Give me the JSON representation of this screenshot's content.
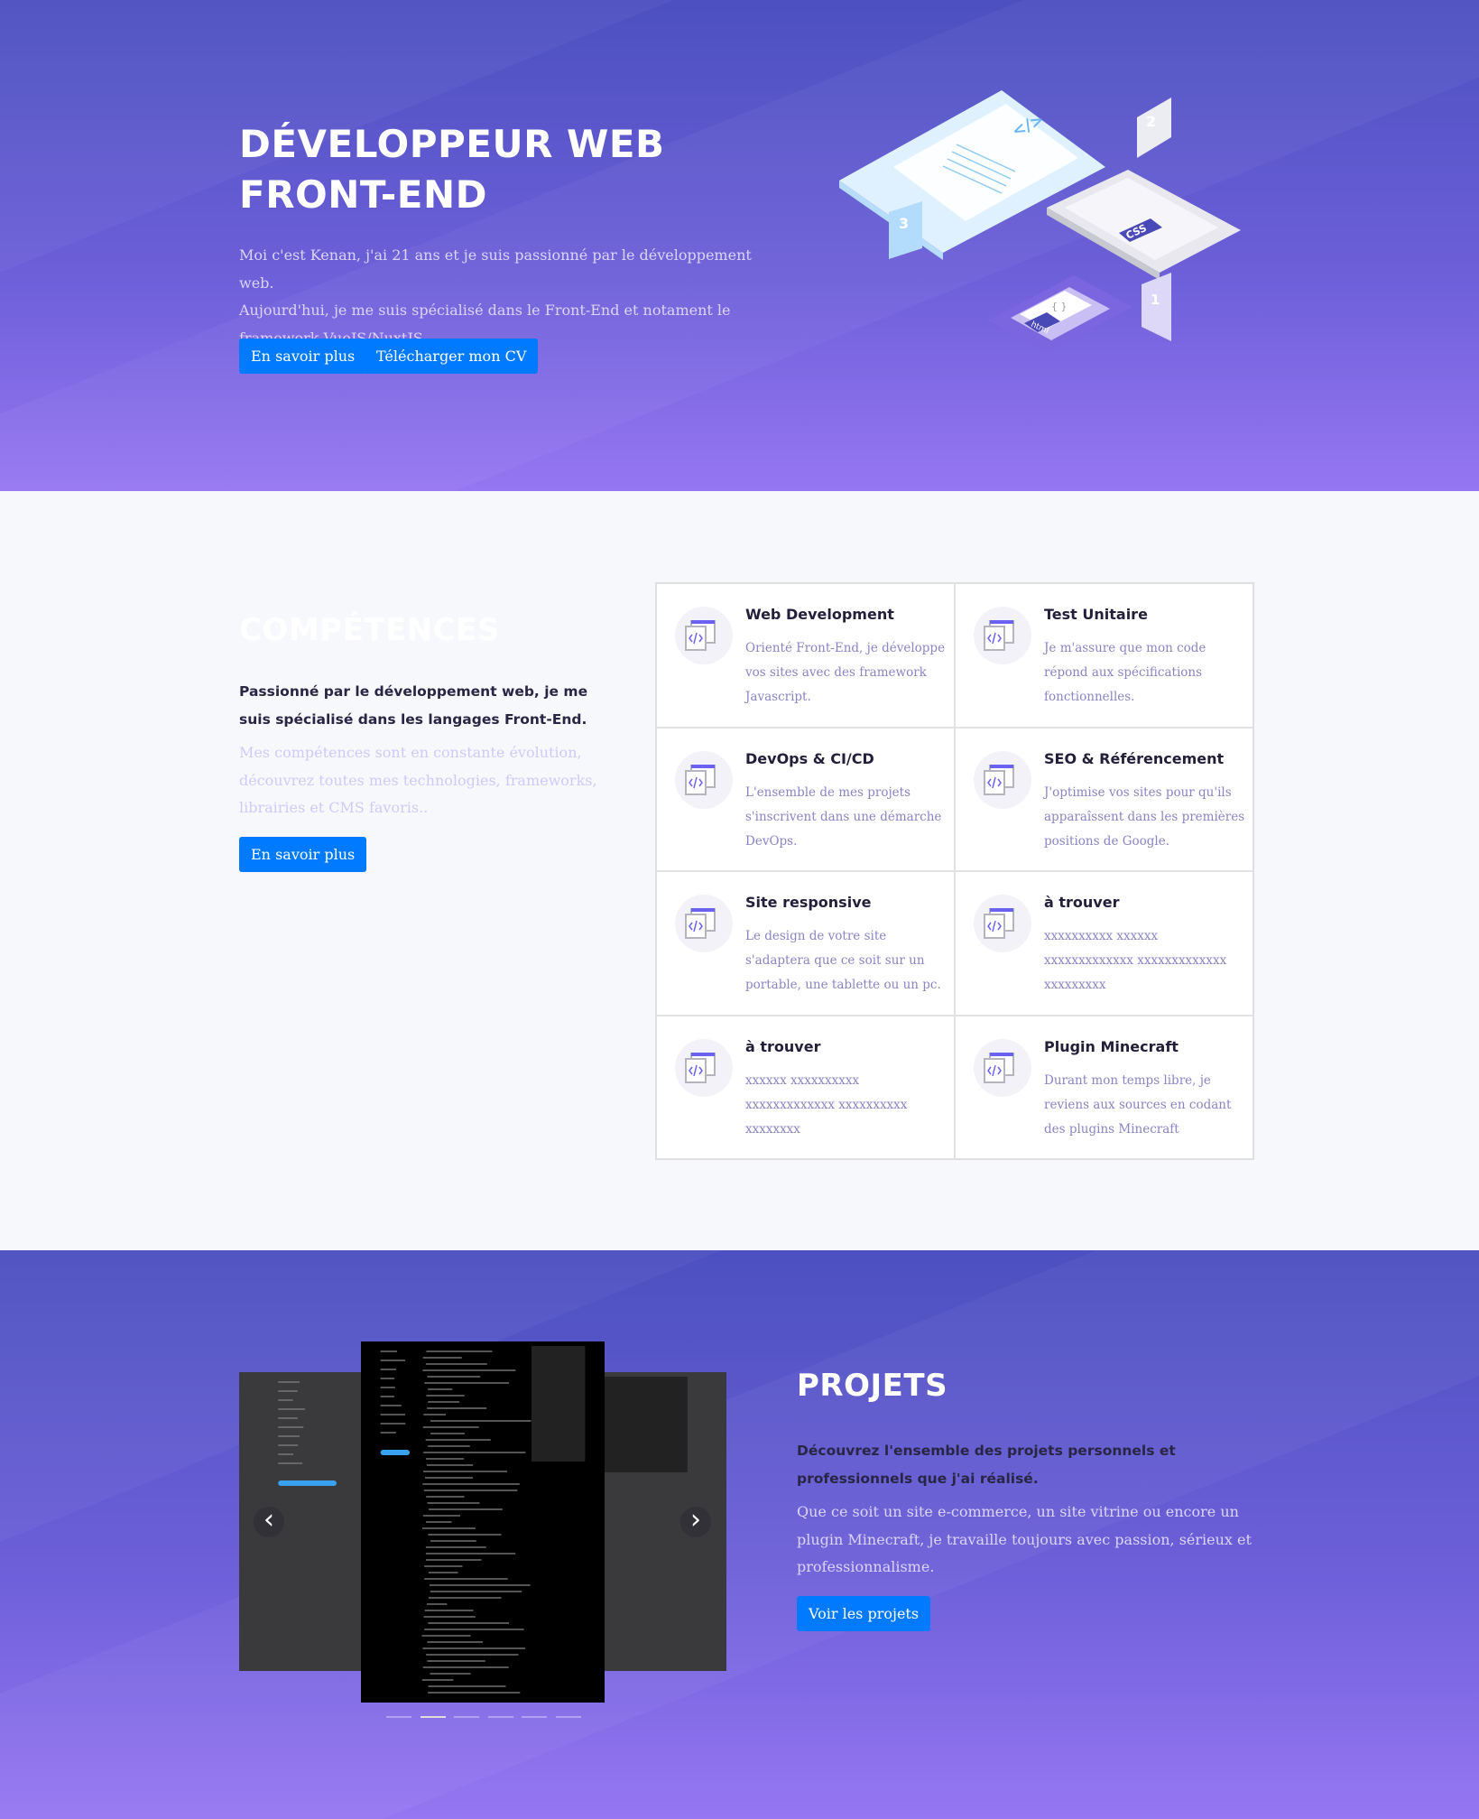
{
  "hero": {
    "title_line1": "DÉVELOPPEUR WEB",
    "title_line2": "FRONT-END",
    "lines": [
      "Moi c'est Kenan, j'ai 21 ans et je suis passionné par le développement web.",
      "Aujourd'hui, je me suis spécialisé dans le Front-End et notament le",
      "framework VueJS/NuxtJS."
    ],
    "btn_more": "En savoir plus",
    "btn_cv": "Télécharger mon CV",
    "illustration_labels": {
      "one": "1",
      "two": "2",
      "three": "3",
      "css": "CSS",
      "html": "html",
      "code": "</>",
      "braces": "{ }"
    }
  },
  "skills": {
    "title": "COMPÉTENCES",
    "strong_lines": [
      "Passionné par le développement web, je me",
      "suis spécialisé dans les langages Front-End."
    ],
    "light_lines": [
      "Mes compétences sont en constante évolution,",
      "découvrez toutes mes technologies, frameworks,",
      "librairies et CMS favoris.."
    ],
    "btn": "En savoir plus",
    "cards": [
      {
        "title": "Web Development",
        "desc": "Orienté Front-End, je développe vos sites avec des framework Javascript.",
        "icon": "code-window-icon"
      },
      {
        "title": "Test Unitaire",
        "desc": "Je m'assure que mon code répond aux spécifications fonctionnelles.",
        "icon": "code-window-icon"
      },
      {
        "title": "DevOps & CI/CD",
        "desc": "L'ensemble de mes projets s'inscrivent dans une démarche DevOps.",
        "icon": "code-window-icon"
      },
      {
        "title": "SEO & Référencement",
        "desc": "J'optimise vos sites pour qu'ils apparaîssent dans les premières positions de Google.",
        "icon": "code-window-icon"
      },
      {
        "title": "Site responsive",
        "desc": "Le design de votre site s'adaptera que ce soit sur un portable, une tablette ou un pc.",
        "icon": "code-window-icon"
      },
      {
        "title": "à trouver",
        "desc": "xxxxxxxxxx xxxxxx xxxxxxxxxxxxx xxxxxxxxxxxxx xxxxxxxxx",
        "icon": "code-window-icon"
      },
      {
        "title": "à trouver",
        "desc": "xxxxxx xxxxxxxxxx xxxxxxxxxxxxx xxxxxxxxxx xxxxxxxx",
        "icon": "code-window-icon"
      },
      {
        "title": "Plugin Minecraft",
        "desc": "Durant mon temps libre, je reviens aux sources en codant des plugins Minecraft",
        "icon": "code-window-icon"
      }
    ]
  },
  "projects": {
    "title": "PROJETS",
    "strong_lines": [
      "Découvrez l'ensemble des projets personnels et",
      "professionnels que j'ai réalisé."
    ],
    "lines": [
      "Que ce soit un site e-commerce, un site vitrine ou encore un",
      "plugin Minecraft, je travaille toujours avec passion, sérieux et",
      "professionnalisme."
    ],
    "btn": "Voir les projets",
    "carousel": {
      "prev_icon": "chevron-left-icon",
      "next_icon": "chevron-right-icon",
      "prev": "‹",
      "next": "›",
      "slide_count": 6,
      "active_index": 1
    }
  },
  "colors": {
    "accent": "#007bff",
    "gradient_top": "#4c50c0",
    "gradient_bottom": "#9676f2",
    "card_text": "#8b84c4",
    "heading_dark": "#231f3a"
  }
}
